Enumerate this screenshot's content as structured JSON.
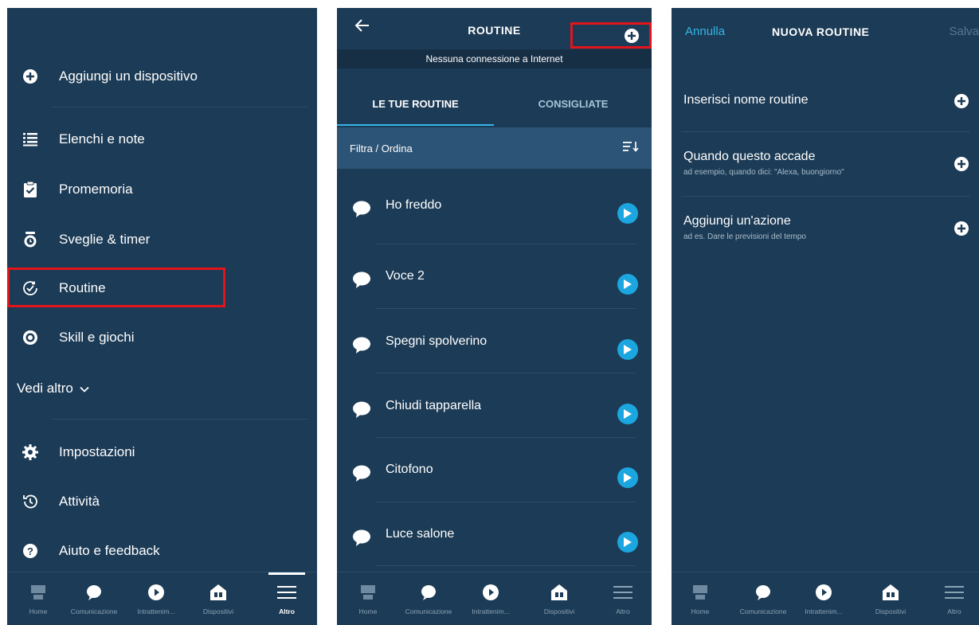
{
  "colors": {
    "background": "#1c3b56",
    "accent": "#35b5e6",
    "highlight_border": "#e3141b"
  },
  "screen1": {
    "menu": [
      {
        "label": "Aggiungi un dispositivo",
        "icon": "plus-circle-icon"
      },
      {
        "label": "Elenchi e note",
        "icon": "list-icon"
      },
      {
        "label": "Promemoria",
        "icon": "clipboard-check-icon"
      },
      {
        "label": "Sveglie & timer",
        "icon": "alarm-clock-icon"
      },
      {
        "label": "Routine",
        "icon": "routine-check-icon"
      },
      {
        "label": "Skill e giochi",
        "icon": "skill-icon"
      },
      {
        "label": "Impostazioni",
        "icon": "gear-icon"
      },
      {
        "label": "Attività",
        "icon": "history-icon"
      },
      {
        "label": "Aiuto e feedback",
        "icon": "help-icon"
      }
    ],
    "more": "Vedi altro",
    "nav": [
      "Home",
      "Comunicazione",
      "Intrattenim...",
      "Dispositivi",
      "Altro"
    ]
  },
  "screen2": {
    "title": "ROUTINE",
    "offline": "Nessuna connessione a Internet",
    "tabs": [
      "LE TUE ROUTINE",
      "CONSIGLIATE"
    ],
    "filter": "Filtra / Ordina",
    "routines": [
      "Ho freddo",
      "Voce 2",
      "Spegni spolverino",
      "Chiudi tapparella",
      "Citofono",
      "Luce salone"
    ],
    "nav": [
      "Home",
      "Comunicazione",
      "Intrattenim...",
      "Dispositivi",
      "Altro"
    ]
  },
  "screen3": {
    "cancel": "Annulla",
    "title": "NUOVA ROUTINE",
    "save": "Salva",
    "fields": [
      {
        "title": "Inserisci nome routine",
        "subtitle": ""
      },
      {
        "title": "Quando questo accade",
        "subtitle": "ad esempio, quando dici: \"Alexa, buongiorno\""
      },
      {
        "title": "Aggiungi un'azione",
        "subtitle": "ad es. Dare le previsioni del tempo"
      }
    ],
    "nav": [
      "Home",
      "Comunicazione",
      "Intrattenim...",
      "Dispositivi",
      "Altro"
    ]
  }
}
